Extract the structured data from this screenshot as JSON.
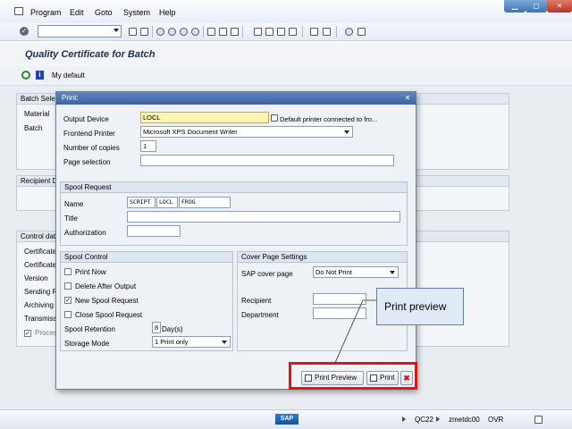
{
  "menu": {
    "items": [
      "Program",
      "Edit",
      "Goto",
      "System",
      "Help"
    ]
  },
  "window": {
    "title": "Quality Certificate for Batch",
    "app_toolbar": {
      "my_default": "My default"
    }
  },
  "background": {
    "batch_group": {
      "header": "Batch Sele",
      "fields": [
        "Material",
        "Batch"
      ]
    },
    "recipient_group": {
      "header": "Recipient D"
    },
    "control_group": {
      "header": "Control dat",
      "fields": [
        "Certificate",
        "Certificate",
        "Version",
        "Sending F",
        "Archiving",
        "Transmiss",
        "Proces"
      ]
    }
  },
  "dialog": {
    "title": "Print:",
    "output_device": {
      "label": "Output Device",
      "value": "LOCL",
      "desc": "Default printer connected to fro..."
    },
    "frontend_printer": {
      "label": "Frontend Printer",
      "value": "Microsoft XPS Document Writer"
    },
    "copies": {
      "label": "Number of copies",
      "value": "1"
    },
    "page_selection": {
      "label": "Page selection",
      "value": ""
    },
    "spool_request": {
      "header": "Spool Request",
      "name_label": "Name",
      "name_parts": [
        "SCRIPT",
        "LOCL",
        "FROG"
      ],
      "title_label": "Title",
      "authorization_label": "Authorization"
    },
    "spool_control": {
      "header": "Spool Control",
      "print_now": {
        "label": "Print Now",
        "checked": false
      },
      "delete_after": {
        "label": "Delete After Output",
        "checked": false
      },
      "new_spool": {
        "label": "New Spool Request",
        "checked": true
      },
      "close_spool": {
        "label": "Close Spool Request",
        "checked": false
      },
      "retention_label": "Spool Retention",
      "retention_value": "8",
      "retention_unit": "Day(s)",
      "storage_label": "Storage Mode",
      "storage_value": "1 Print only"
    },
    "cover_page": {
      "header": "Cover Page Settings",
      "sap_cover_label": "SAP cover page",
      "sap_cover_value": "Do Not Print",
      "recipient_label": "Recipient",
      "department_label": "Department"
    },
    "buttons": {
      "print_preview": "Print Preview",
      "print": "Print",
      "cancel": "✖"
    }
  },
  "callout": {
    "text": "Print preview"
  },
  "status": {
    "tcode": "QC22",
    "server": "zmetdc00",
    "mode": "OVR"
  },
  "colors": {
    "title_bar": "#3d659b",
    "highlight": "#e01414",
    "required": "#fdf3b2"
  }
}
